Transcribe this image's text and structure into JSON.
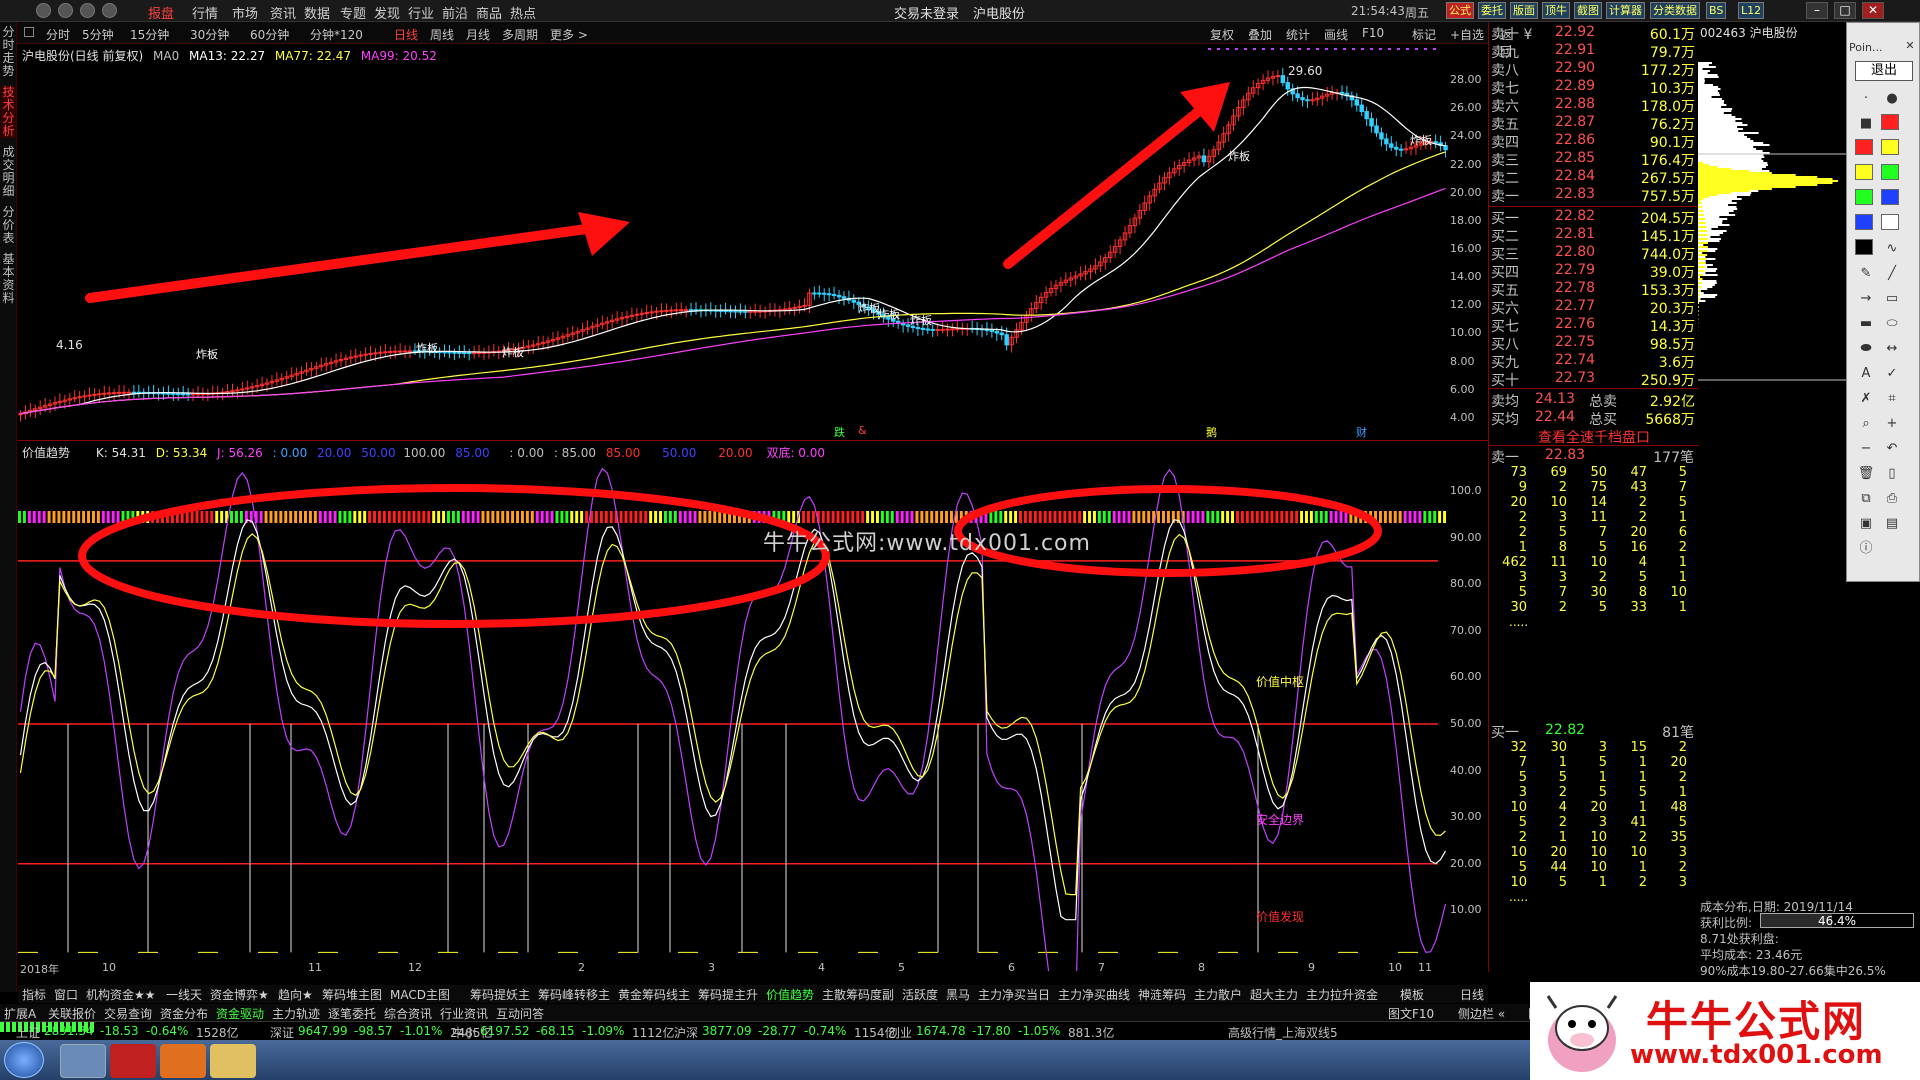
{
  "app": {
    "title": "交易未登录",
    "stock_name": "沪电股份",
    "clock": "21:54:43",
    "weekday": "周五"
  },
  "top_menu": [
    "报盘",
    "行情",
    "市场",
    "资讯",
    "数据",
    "专题",
    "发现",
    "行业",
    "前沿",
    "商品",
    "热点"
  ],
  "top_right_buttons": [
    "公式",
    "委托",
    "版面",
    "顶牛",
    "截图",
    "计算器",
    "分类数据",
    "BS",
    "L12"
  ],
  "timeframes": [
    "分时",
    "5分钟",
    "15分钟",
    "30分钟",
    "60分钟",
    "分钟*120",
    "日线",
    "周线",
    "月线",
    "多周期",
    "更多 >"
  ],
  "timeframe_active": "日线",
  "chart_tools": [
    "复权",
    "叠加",
    "统计",
    "画线",
    "F10",
    "标记",
    "+自选",
    "返回"
  ],
  "left_tabs": [
    "分时走势",
    "技术分析",
    "成交明细",
    "分价表",
    "基本资料"
  ],
  "main_legend": {
    "title": "沪电股份(日线 前复权)",
    "ma0": "MA0",
    "ma13": "MA13: 22.27",
    "ma77": "MA77: 22.47",
    "ma99": "MA99: 20.52",
    "high_label": "29.60",
    "low_label": "4.16"
  },
  "main_yaxis": [
    "28.00",
    "26.00",
    "24.00",
    "22.00",
    "20.00",
    "18.00",
    "16.00",
    "14.00",
    "12.00",
    "10.00",
    "8.00",
    "6.00",
    "4.00"
  ],
  "event_labels": [
    "炸板",
    "炸板",
    "炸板",
    "炸板",
    "炸板",
    "炸板",
    "炸板",
    "炸板"
  ],
  "signal_labels": [
    "跌",
    "&",
    "鹅",
    "财"
  ],
  "indicator_legend": {
    "name": "价值趋势",
    "k": "K: 54.31",
    "d": "D: 53.34",
    "j": "J: 56.26",
    "v1": ": 0.00",
    "v2": "20.00",
    "v3": "50.00",
    "v4": "100.00",
    "v5": "85.00",
    "v6": ": 0.00",
    "v7": ": 85.00",
    "v8": "85.00",
    "v9": "50.00",
    "v10": "20.00",
    "v11": "双底: 0.00"
  },
  "ind_yaxis": [
    "100.0",
    "90.00",
    "80.00",
    "70.00",
    "60.00",
    "50.00",
    "40.00",
    "30.00",
    "20.00",
    "10.00"
  ],
  "ind_text": {
    "watermark": "牛牛公式网:www.tdx001.com",
    "zone_mid": "价值中枢",
    "zone_safe": "安全边界",
    "zone_find": "价值发现"
  },
  "xaxis": [
    "2018年",
    "10",
    "11",
    "12",
    "2",
    "3",
    "4",
    "5",
    "6",
    "7",
    "8",
    "9",
    "10",
    "11"
  ],
  "sell_orders": [
    {
      "label": "卖十 ¥",
      "price": "22.92",
      "vol": "60.1万"
    },
    {
      "label": "卖九",
      "price": "22.91",
      "vol": "79.7万"
    },
    {
      "label": "卖八",
      "price": "22.90",
      "vol": "177.2万"
    },
    {
      "label": "卖七",
      "price": "22.89",
      "vol": "10.3万"
    },
    {
      "label": "卖六",
      "price": "22.88",
      "vol": "178.0万"
    },
    {
      "label": "卖五",
      "price": "22.87",
      "vol": "76.2万"
    },
    {
      "label": "卖四",
      "price": "22.86",
      "vol": "90.1万"
    },
    {
      "label": "卖三",
      "price": "22.85",
      "vol": "176.4万"
    },
    {
      "label": "卖二",
      "price": "22.84",
      "vol": "267.5万"
    },
    {
      "label": "卖一",
      "price": "22.83",
      "vol": "757.5万"
    }
  ],
  "buy_orders": [
    {
      "label": "买一",
      "price": "22.82",
      "vol": "204.5万"
    },
    {
      "label": "买二",
      "price": "22.81",
      "vol": "145.1万"
    },
    {
      "label": "买三",
      "price": "22.80",
      "vol": "744.0万"
    },
    {
      "label": "买四",
      "price": "22.79",
      "vol": "39.0万"
    },
    {
      "label": "买五",
      "price": "22.78",
      "vol": "153.3万"
    },
    {
      "label": "买六",
      "price": "22.77",
      "vol": "20.3万"
    },
    {
      "label": "买七",
      "price": "22.76",
      "vol": "14.3万"
    },
    {
      "label": "买八",
      "price": "22.75",
      "vol": "98.5万"
    },
    {
      "label": "买九",
      "price": "22.74",
      "vol": "3.6万"
    },
    {
      "label": "买十",
      "price": "22.73",
      "vol": "250.9万"
    }
  ],
  "avg": {
    "sell_label": "卖均",
    "sell_price": "24.13",
    "sell_total_label": "总卖",
    "sell_total": "2.92亿",
    "buy_label": "买均",
    "buy_price": "22.44",
    "buy_total_label": "总买",
    "buy_total": "5668万"
  },
  "view_full_depth": "查看全速千档盘口",
  "sell1_queue": {
    "label": "卖一",
    "price": "22.83",
    "count": "177笔",
    "rows": [
      [
        "73",
        "69",
        "50",
        "47",
        "5"
      ],
      [
        "9",
        "2",
        "75",
        "43",
        "7"
      ],
      [
        "20",
        "10",
        "14",
        "2",
        "5"
      ],
      [
        "2",
        "3",
        "11",
        "2",
        "1"
      ],
      [
        "2",
        "5",
        "7",
        "20",
        "6"
      ],
      [
        "1",
        "8",
        "5",
        "16",
        "2"
      ],
      [
        "462",
        "11",
        "10",
        "4",
        "1"
      ],
      [
        "3",
        "3",
        "2",
        "5",
        "1"
      ],
      [
        "5",
        "7",
        "30",
        "8",
        "10"
      ],
      [
        "30",
        "2",
        "5",
        "33",
        "1"
      ]
    ],
    "more": "....."
  },
  "buy1_queue": {
    "label": "买一",
    "price": "22.82",
    "count": "81笔",
    "rows": [
      [
        "32",
        "30",
        "3",
        "15",
        "2"
      ],
      [
        "7",
        "1",
        "5",
        "1",
        "20"
      ],
      [
        "5",
        "5",
        "1",
        "1",
        "2"
      ],
      [
        "3",
        "2",
        "5",
        "5",
        "1"
      ],
      [
        "10",
        "4",
        "20",
        "1",
        "48"
      ],
      [
        "5",
        "2",
        "3",
        "41",
        "5"
      ],
      [
        "2",
        "1",
        "10",
        "2",
        "35"
      ],
      [
        "10",
        "20",
        "10",
        "10",
        "3"
      ],
      [
        "5",
        "44",
        "10",
        "1",
        "2"
      ],
      [
        "10",
        "5",
        "1",
        "2",
        "3"
      ]
    ],
    "more": "....."
  },
  "depth_header": "002463 沪电股份",
  "palette": {
    "label": "Poin...",
    "exit": "退出"
  },
  "cost": {
    "date": "成本分布,日期: 2019/11/14",
    "profit_label": "获利比例:",
    "profit_value": "46.4%",
    "profit_line": "8.71处获利盘:",
    "avg_cost": "平均成本: 23.46元",
    "concentration": "90%成本19.80-27.66集中26.5%"
  },
  "bottom_tabs": [
    "指标",
    "窗口",
    "机构资金★★",
    "一线天",
    "资金博弈★",
    "趋向★",
    "筹码堆主图",
    "MACD主图",
    "筹码提妖主",
    "筹码峰转移主",
    "黄金筹码线主",
    "筹码提主升",
    "价值趋势",
    "主散筹码度副",
    "活跃度",
    "黑马",
    "主力净买当日",
    "主力净买曲线",
    "神涟筹码",
    "主力散户",
    "超大主力",
    "主力拉升资金"
  ],
  "bottom_tab_active": "价值趋势",
  "bottom_tabs_right": [
    "模板",
    "日线"
  ],
  "bottom_tabs2": [
    "扩展A",
    "关联报价",
    "交易查询",
    "资金分布",
    "资金驱动",
    "主力轨迹",
    "逐笔委托",
    "综合资讯",
    "行业资讯",
    "互动问答"
  ],
  "bottom_tabs2_right": [
    "图文F10",
    "侧边栏 «",
    "队列"
  ],
  "status": [
    {
      "name": "上证",
      "val": "2891.34",
      "chg": "-18.53",
      "pct": "-0.64%",
      "amt": "1528亿"
    },
    {
      "name": "深证",
      "val": "9647.99",
      "chg": "-98.57",
      "pct": "-1.01%",
      "amt": "2485亿"
    },
    {
      "name": "中小",
      "val": "6197.52",
      "chg": "-68.15",
      "pct": "-1.09%",
      "amt": "1112亿"
    },
    {
      "name": "沪深",
      "val": "3877.09",
      "chg": "-28.77",
      "pct": "-0.74%",
      "amt": "1154亿"
    },
    {
      "name": "创业",
      "val": "1674.78",
      "chg": "-17.80",
      "pct": "-1.05%",
      "amt": "881.3亿"
    }
  ],
  "status_right": "高级行情_上海双线5",
  "brand": {
    "title": "牛牛公式网",
    "url": "www.tdx001.com"
  }
}
